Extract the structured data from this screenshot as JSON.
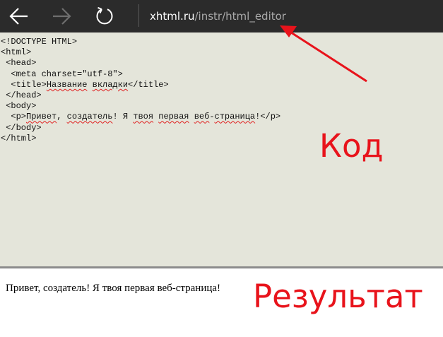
{
  "browser": {
    "back_icon": "arrow-left-icon",
    "forward_icon": "arrow-right-icon",
    "refresh_icon": "refresh-icon",
    "address_domain": "xhtml.ru",
    "address_path": "/instr/html_editor"
  },
  "editor": {
    "lines": [
      "<!DOCTYPE HTML>",
      "<html>",
      " <head>",
      "  <meta charset=\"utf-8\">",
      "  <title>Название вкладки</title>",
      " </head>",
      " <body>",
      "  <p>Привет, создатель! Я твоя первая веб-страница!</p>",
      " </body>",
      "</html>"
    ]
  },
  "preview": {
    "text": "Привет, создатель! Я твоя первая веб-страница!"
  },
  "annotations": {
    "code_label": "Код",
    "result_label": "Результат",
    "color": "#e8131b"
  }
}
